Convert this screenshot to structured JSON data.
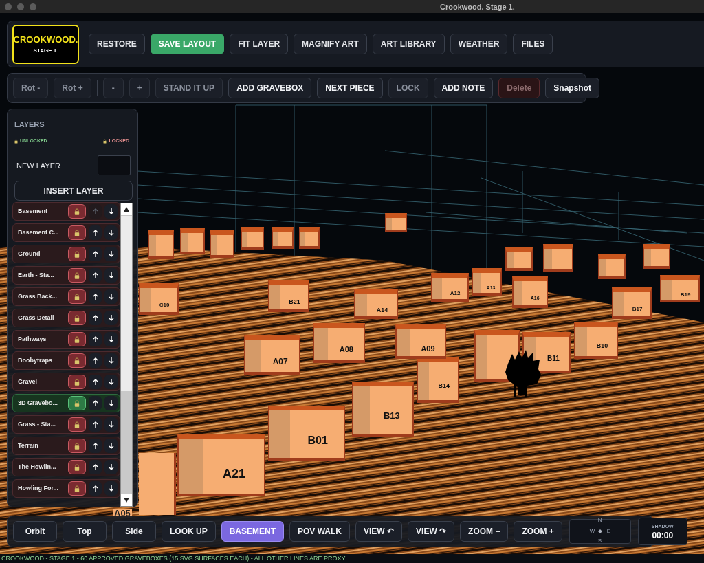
{
  "window": {
    "title": "Crookwood. Stage 1."
  },
  "logo": {
    "title": "CROOKWOOD.",
    "subtitle": "STAGE 1."
  },
  "main_toolbar": [
    {
      "label": "RESTORE",
      "kind": "plain"
    },
    {
      "label": "SAVE LAYOUT",
      "kind": "primary"
    },
    {
      "label": "FIT LAYER",
      "kind": "plain"
    },
    {
      "label": "MAGNIFY ART",
      "kind": "plain"
    },
    {
      "label": "ART LIBRARY",
      "kind": "plain"
    },
    {
      "label": "WEATHER",
      "kind": "plain"
    },
    {
      "label": "FILES",
      "kind": "plain"
    }
  ],
  "edit_toolbar": [
    {
      "buttons": [
        {
          "label": "Rot -",
          "kind": "plain",
          "disabled": true
        },
        {
          "label": "Rot +",
          "kind": "plain",
          "disabled": true
        }
      ]
    },
    {
      "buttons": [
        {
          "label": "-",
          "kind": "plain",
          "disabled": true
        },
        {
          "label": "+",
          "kind": "plain",
          "disabled": true
        },
        {
          "label": "STAND IT UP",
          "kind": "plain",
          "disabled": true
        },
        {
          "label": "ADD GRAVEBOX",
          "kind": "plain",
          "disabled": false
        },
        {
          "label": "NEXT PIECE",
          "kind": "plain",
          "disabled": false
        },
        {
          "label": "LOCK",
          "kind": "plain",
          "disabled": true
        },
        {
          "label": "ADD NOTE",
          "kind": "plain",
          "disabled": false
        },
        {
          "label": "Delete",
          "kind": "danger",
          "disabled": true
        },
        {
          "label": "Snapshot",
          "kind": "plain",
          "disabled": false
        }
      ]
    }
  ],
  "layers_panel": {
    "title": "LAYERS",
    "legend_unlocked": "UNLOCKED",
    "legend_locked": "LOCKED",
    "new_layer_label": "NEW LAYER",
    "insert_button": "INSERT LAYER",
    "layers": [
      {
        "name": "Basement",
        "locked": true,
        "selected": false,
        "up_disabled": true
      },
      {
        "name": "Basement C...",
        "locked": true,
        "selected": false,
        "up_disabled": false
      },
      {
        "name": "Ground",
        "locked": true,
        "selected": false,
        "up_disabled": false
      },
      {
        "name": "Earth - Sta...",
        "locked": true,
        "selected": false,
        "up_disabled": false
      },
      {
        "name": "Grass Back...",
        "locked": true,
        "selected": false,
        "up_disabled": false
      },
      {
        "name": "Grass Detail",
        "locked": true,
        "selected": false,
        "up_disabled": false
      },
      {
        "name": "Pathways",
        "locked": true,
        "selected": false,
        "up_disabled": false
      },
      {
        "name": "Boobytraps",
        "locked": true,
        "selected": false,
        "up_disabled": false
      },
      {
        "name": "Gravel",
        "locked": true,
        "selected": false,
        "up_disabled": false
      },
      {
        "name": "3D Gravebo...",
        "locked": false,
        "selected": true,
        "up_disabled": false
      },
      {
        "name": "Grass - Sta...",
        "locked": true,
        "selected": false,
        "up_disabled": false
      },
      {
        "name": "Terrain",
        "locked": true,
        "selected": false,
        "up_disabled": false
      },
      {
        "name": "The Howlin...",
        "locked": true,
        "selected": false,
        "up_disabled": false
      },
      {
        "name": "Howling For...",
        "locked": true,
        "selected": false,
        "up_disabled": false
      }
    ]
  },
  "scene": {
    "graveboxes": [
      "A21",
      "B01",
      "B13",
      "B14",
      "A07",
      "A08",
      "A09",
      "A14",
      "B21",
      "C10",
      "A12",
      "A13",
      "A16",
      "B10",
      "B11",
      "B17",
      "B19"
    ],
    "floor_label": "A05"
  },
  "view_toolbar": [
    {
      "label": "Orbit",
      "selected": false
    },
    {
      "label": "Top",
      "selected": false
    },
    {
      "label": "Side",
      "selected": false
    },
    {
      "label": "LOOK UP",
      "selected": false
    },
    {
      "label": "BASEMENT",
      "selected": true
    },
    {
      "label": "POV WALK",
      "selected": false
    },
    {
      "label": "VIEW ↶",
      "selected": false
    },
    {
      "label": "VIEW ↷",
      "selected": false
    },
    {
      "label": "ZOOM −",
      "selected": false
    },
    {
      "label": "ZOOM +",
      "selected": false
    }
  ],
  "compass": {
    "north": "N",
    "west": "W",
    "east": "E",
    "south": "S"
  },
  "shadow": {
    "label": "SHADOW",
    "time": "00:00"
  },
  "status_bar": "CROOKWOOD - STAGE 1 - 60 APPROVED GRAVEBOXES (15 SVG SURFACES EACH) - ALL OTHER LINES ARE PROXY"
}
